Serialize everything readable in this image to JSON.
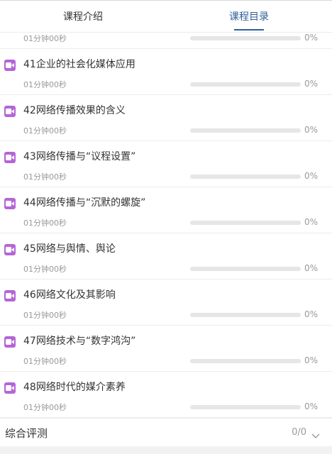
{
  "tabs": [
    {
      "label": "课程介绍",
      "active": false
    },
    {
      "label": "课程目录",
      "active": true
    }
  ],
  "lessons": [
    {
      "title": "",
      "duration": "01分钟00秒",
      "progress": 0,
      "progress_label": "0%"
    },
    {
      "title": "41企业的社会化媒体应用",
      "duration": "01分钟00秒",
      "progress": 0,
      "progress_label": "0%"
    },
    {
      "title": "42网络传播效果的含义",
      "duration": "01分钟00秒",
      "progress": 0,
      "progress_label": "0%"
    },
    {
      "title": "43网络传播与“议程设置”",
      "duration": "01分钟00秒",
      "progress": 0,
      "progress_label": "0%"
    },
    {
      "title": "44网络传播与“沉默的螺旋”",
      "duration": "01分钟00秒",
      "progress": 0,
      "progress_label": "0%"
    },
    {
      "title": "45网络与舆情、舆论",
      "duration": "01分钟00秒",
      "progress": 0,
      "progress_label": "0%"
    },
    {
      "title": "46网络文化及其影响",
      "duration": "01分钟00秒",
      "progress": 0,
      "progress_label": "0%"
    },
    {
      "title": "47网络技术与“数字鸿沟”",
      "duration": "01分钟00秒",
      "progress": 0,
      "progress_label": "0%"
    },
    {
      "title": "48网络时代的媒介素养",
      "duration": "01分钟00秒",
      "progress": 0,
      "progress_label": "0%"
    }
  ],
  "summary": {
    "label": "综合评测",
    "count": "0/0"
  },
  "icons": {
    "lesson": "video-camera-icon",
    "summary": "chevron-down-icon"
  },
  "colors": {
    "accent": "#2f5f9a",
    "video_icon": "#b565d8"
  }
}
